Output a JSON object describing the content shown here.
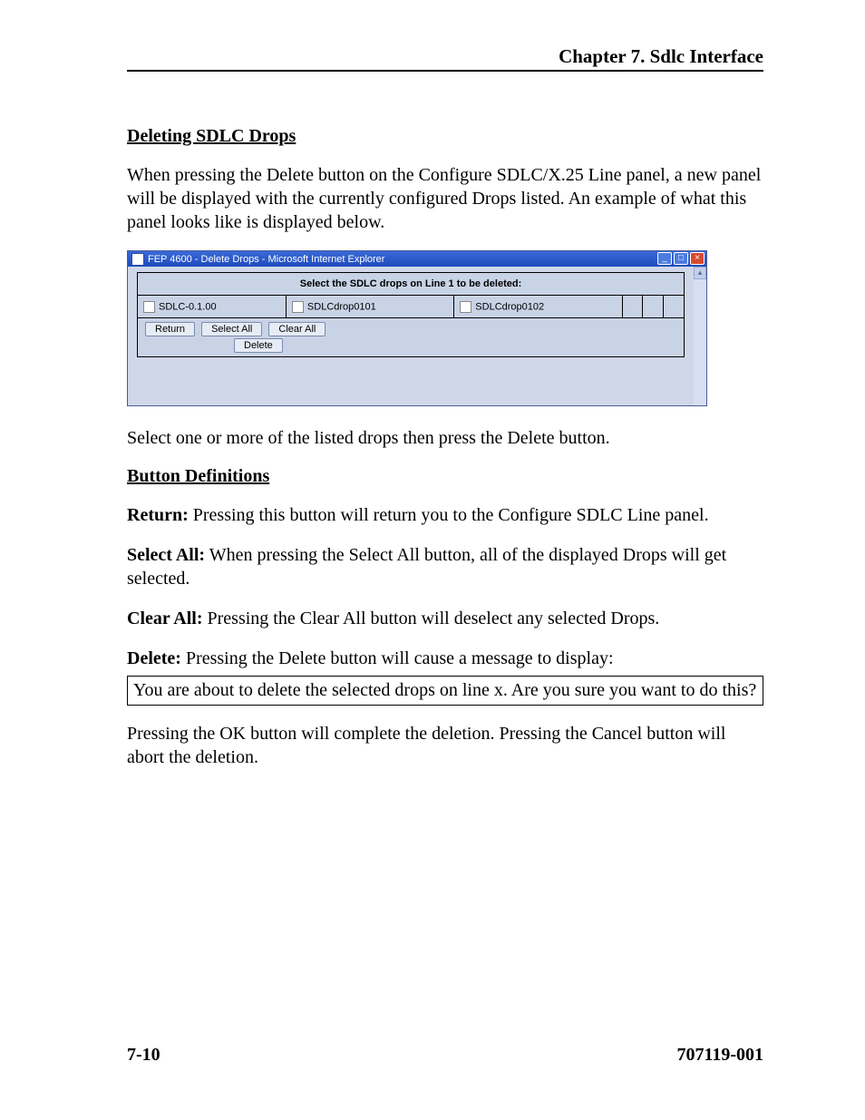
{
  "header": {
    "chapter": "Chapter 7. Sdlc Interface"
  },
  "sections": {
    "deleting_title": "Deleting SDLC Drops",
    "deleting_intro": "When pressing the Delete button on the Configure SDLC/X.25 Line panel, a new panel will be displayed with the currently configured Drops listed. An example of what this panel looks like is displayed below.",
    "after_screenshot": "Select one or more of the listed drops then press the Delete button.",
    "button_defs_title": "Button Definitions",
    "definitions": {
      "return_label": "Return:",
      "return_text": "  Pressing this button will return you to the Configure SDLC Line panel.",
      "selectall_label": "Select All:",
      "selectall_text": "  When pressing the Select All button, all of the displayed Drops will get selected.",
      "clearall_label": "Clear All:",
      "clearall_text": "  Pressing the Clear All button will deselect any selected Drops.",
      "delete_label": "Delete:",
      "delete_text": "  Pressing the Delete button will cause a message to display:"
    },
    "confirm_msg": "You are about to delete the selected drops on line x. Are you sure you want to do this?",
    "closing": "Pressing the OK button will complete the deletion. Pressing the Cancel button will abort the deletion."
  },
  "screenshot": {
    "title": "FEP 4600 - Delete Drops - Microsoft Internet Explorer",
    "panel_heading": "Select the SDLC drops on Line 1 to be deleted:",
    "drops": [
      "SDLC-0.1.00",
      "SDLCdrop0101",
      "SDLCdrop0102"
    ],
    "buttons": {
      "return": "Return",
      "select_all": "Select All",
      "clear_all": "Clear All",
      "delete": "Delete"
    }
  },
  "footer": {
    "page_num": "7-10",
    "doc_num": "707119-001"
  }
}
